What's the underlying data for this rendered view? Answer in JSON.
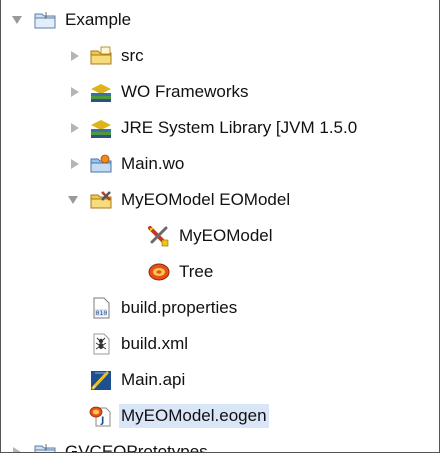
{
  "tree": {
    "items": [
      {
        "label": "Example",
        "icon": "project-folder-icon",
        "expanded": true
      },
      {
        "label": "src",
        "icon": "source-folder-icon",
        "expanded": false
      },
      {
        "label": "WO Frameworks",
        "icon": "library-icon",
        "expanded": false
      },
      {
        "label": "JRE System Library [JVM 1.5.0",
        "icon": "library-icon",
        "expanded": false
      },
      {
        "label": "Main.wo",
        "icon": "wo-component-folder-icon",
        "expanded": false
      },
      {
        "label": "MyEOModel EOModel",
        "icon": "eomodel-folder-icon",
        "expanded": true
      },
      {
        "label": "MyEOModel",
        "icon": "eomodel-tools-icon"
      },
      {
        "label": "Tree",
        "icon": "entity-icon"
      },
      {
        "label": "build.properties",
        "icon": "properties-file-icon"
      },
      {
        "label": "build.xml",
        "icon": "ant-file-icon"
      },
      {
        "label": "Main.api",
        "icon": "api-file-icon"
      },
      {
        "label": "MyEOModel.eogen",
        "icon": "eogen-file-icon",
        "selected": true
      },
      {
        "label": "GVCEOPrototypes",
        "icon": "project-folder-icon",
        "expanded": false
      }
    ]
  }
}
